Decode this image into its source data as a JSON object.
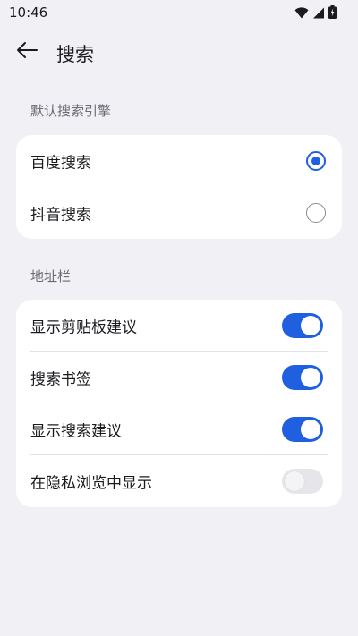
{
  "status_bar": {
    "time": "10:46",
    "icons": [
      "wifi-icon",
      "cellular-signal-icon",
      "battery-icon"
    ]
  },
  "header": {
    "back_icon": "back-arrow-icon",
    "title": "搜索"
  },
  "default_search_engine": {
    "label": "默认搜索引擎",
    "options": [
      {
        "label": "百度搜索",
        "selected": true
      },
      {
        "label": "抖音搜索",
        "selected": false
      }
    ]
  },
  "address_bar": {
    "label": "地址栏",
    "settings": [
      {
        "label": "显示剪贴板建议",
        "enabled": true
      },
      {
        "label": "搜索书签",
        "enabled": true
      },
      {
        "label": "显示搜索建议",
        "enabled": true
      },
      {
        "label": "在隐私浏览中显示",
        "enabled": false
      }
    ]
  },
  "colors": {
    "accent": "#1f5fe0",
    "background": "#f1f0f5",
    "card": "#ffffff"
  }
}
